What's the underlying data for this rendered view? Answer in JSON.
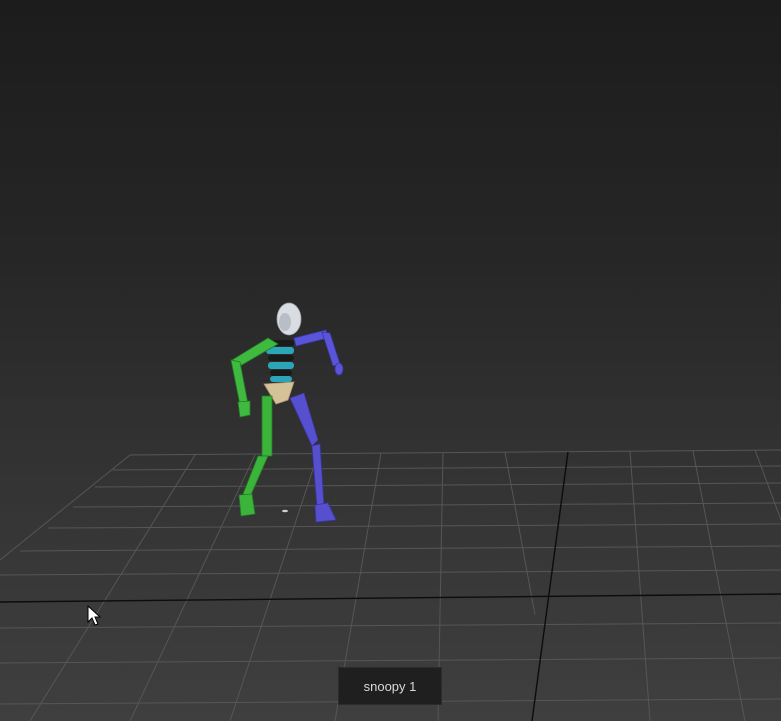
{
  "viewport": {
    "character_label": "snoopy 1"
  },
  "colors": {
    "background_top": "#1c1c1c",
    "background_bottom": "#3f3f3f",
    "grid_line": "#5a5a5a",
    "grid_axis": "#0a0a0a",
    "left_limbs": "#3db53d",
    "right_limbs": "#5b56d6",
    "spine": "#2aa6b8",
    "pelvis": "#d8c49a",
    "head": "#d9dde3"
  },
  "icons": {
    "cursor": "arrow-cursor-icon"
  }
}
